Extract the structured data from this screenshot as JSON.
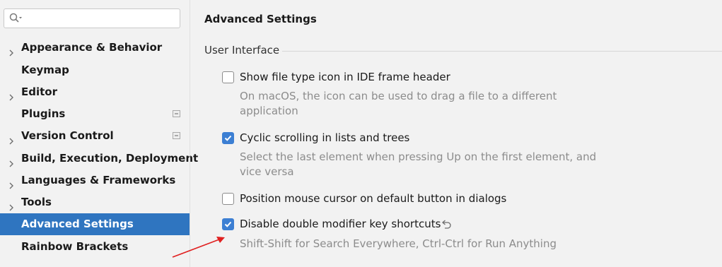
{
  "search": {
    "value": "",
    "placeholder": ""
  },
  "sidebar": {
    "items": [
      {
        "label": "Appearance & Behavior",
        "expandable": true
      },
      {
        "label": "Keymap",
        "expandable": false
      },
      {
        "label": "Editor",
        "expandable": true
      },
      {
        "label": "Plugins",
        "expandable": false
      },
      {
        "label": "Version Control",
        "expandable": true
      },
      {
        "label": "Build, Execution, Deployment",
        "expandable": true
      },
      {
        "label": "Languages & Frameworks",
        "expandable": true
      },
      {
        "label": "Tools",
        "expandable": true
      },
      {
        "label": "Advanced Settings",
        "expandable": false,
        "selected": true
      },
      {
        "label": "Rainbow Brackets",
        "expandable": false
      }
    ]
  },
  "main": {
    "title": "Advanced Settings",
    "section": "User Interface",
    "options": [
      {
        "label": "Show file type icon in IDE frame header",
        "checked": false,
        "desc": [
          "On macOS, the icon can be used to drag a file to a different",
          "application"
        ]
      },
      {
        "label": "Cyclic scrolling in lists and trees",
        "checked": true,
        "desc": [
          "Select the last element when pressing Up on the first element, and",
          "vice versa"
        ]
      },
      {
        "label": "Position mouse cursor on default button in dialogs",
        "checked": false,
        "desc": []
      },
      {
        "label": "Disable double modifier key shortcuts",
        "checked": true,
        "desc": [
          "Shift-Shift for Search Everywhere, Ctrl-Ctrl for Run Anything"
        ]
      }
    ]
  },
  "colors": {
    "selection": "#2f75c0",
    "checkbox_checked": "#3c7fd3",
    "annotation_arrow": "#e02020"
  }
}
